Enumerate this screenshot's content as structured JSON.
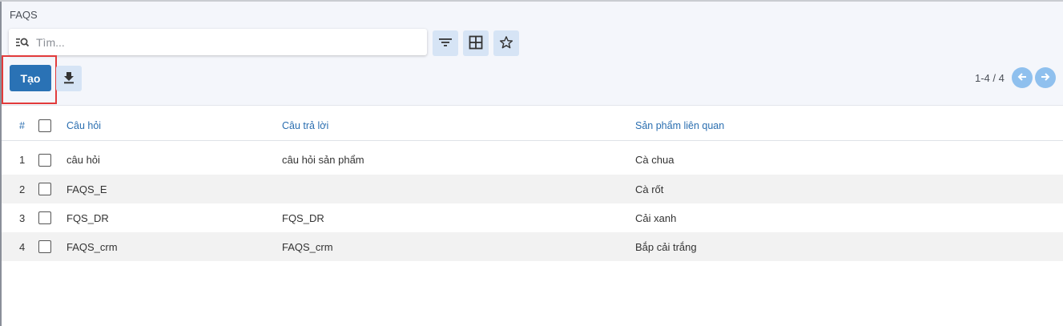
{
  "breadcrumb": "FAQS",
  "search": {
    "placeholder": "Tìm..."
  },
  "toolbar": {
    "filter_icon": "filter-lines-icon",
    "layout_icon": "grid-icon",
    "favorite_icon": "star-icon",
    "create_label": "Tạo",
    "download_icon": "download-icon"
  },
  "pager": {
    "value": "1-4 / 4",
    "prev_icon": "arrow-left-icon",
    "next_icon": "arrow-right-icon"
  },
  "table": {
    "headers": {
      "index": "#",
      "question": "Câu hỏi",
      "answer": "Câu trả lời",
      "product": "Sản phẩm liên quan"
    },
    "rows": [
      {
        "index": "1",
        "question": "câu hỏi",
        "answer": "câu hỏi sản phẩm",
        "product": "Cà chua"
      },
      {
        "index": "2",
        "question": "FAQS_E",
        "answer": "",
        "product": "Cà rốt"
      },
      {
        "index": "3",
        "question": "FQS_DR",
        "answer": "FQS_DR",
        "product": "Cải xanh"
      },
      {
        "index": "4",
        "question": "FAQS_crm",
        "answer": "FAQS_crm",
        "product": "Bắp cải trắng"
      }
    ]
  },
  "colors": {
    "primary": "#2a72b5",
    "tool_bg": "#d6e4f5",
    "header_text": "#2a6eb0",
    "highlight": "#e23b3b"
  }
}
